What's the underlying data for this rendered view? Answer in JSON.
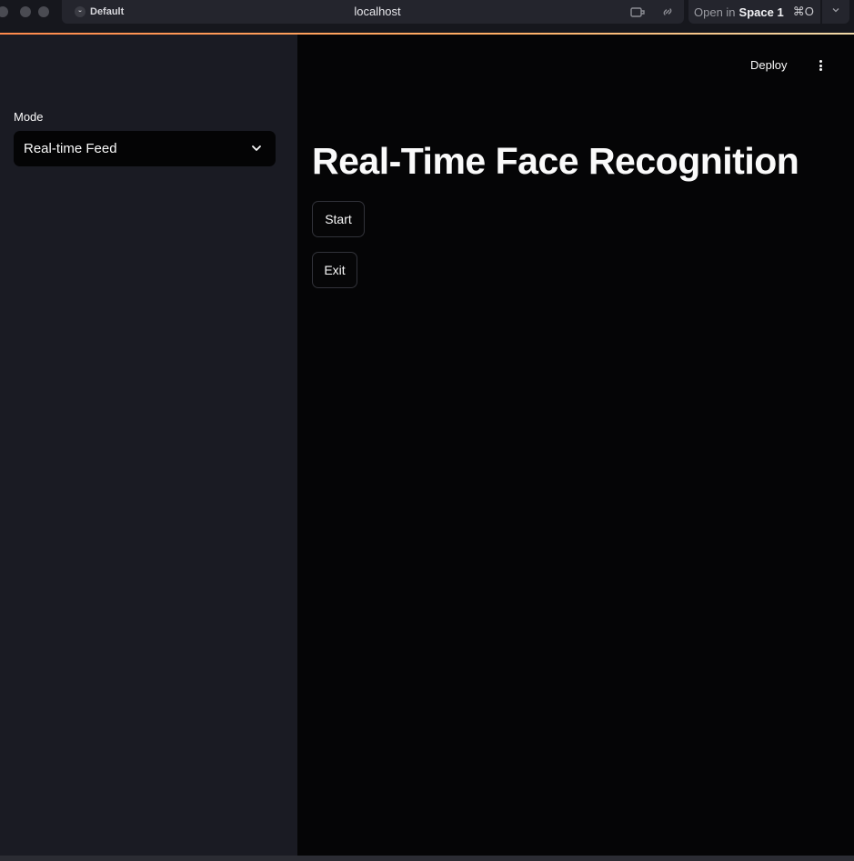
{
  "browser": {
    "profile_name": "Default",
    "profile_icon": "smiley-icon",
    "url": "localhost",
    "open_in_prefix": "Open in",
    "open_in_target": "Space 1",
    "open_in_shortcut": "⌘O",
    "accent_colors": [
      "#ff8a4c",
      "#ffb067",
      "#f0d9a8"
    ]
  },
  "sidebar": {
    "mode_label": "Mode",
    "mode_select_value": "Real-time Feed"
  },
  "header": {
    "deploy_label": "Deploy"
  },
  "main": {
    "title": "Real-Time Face Recognition",
    "start_label": "Start",
    "exit_label": "Exit"
  }
}
